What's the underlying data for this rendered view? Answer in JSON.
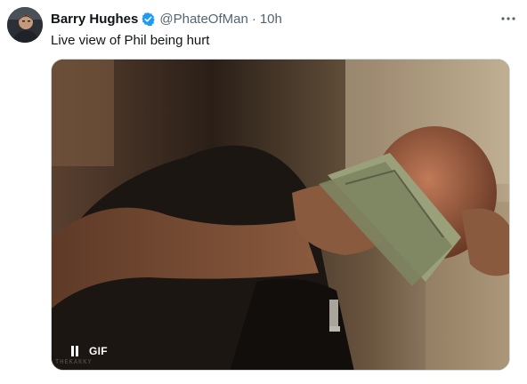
{
  "author": {
    "name": "Barry Hughes",
    "handle": "@PhateOfMan",
    "separator": "·",
    "time": "10h",
    "verified_color": "#1d9bf0"
  },
  "tweet": {
    "text": "Live view of Phil being hurt"
  },
  "media": {
    "type_badge": "GIF",
    "state": "playing",
    "icons": [
      "pause-icon"
    ]
  },
  "colors": {
    "name": "#0f1419",
    "secondary": "#536471",
    "border": "#cfd9de"
  }
}
